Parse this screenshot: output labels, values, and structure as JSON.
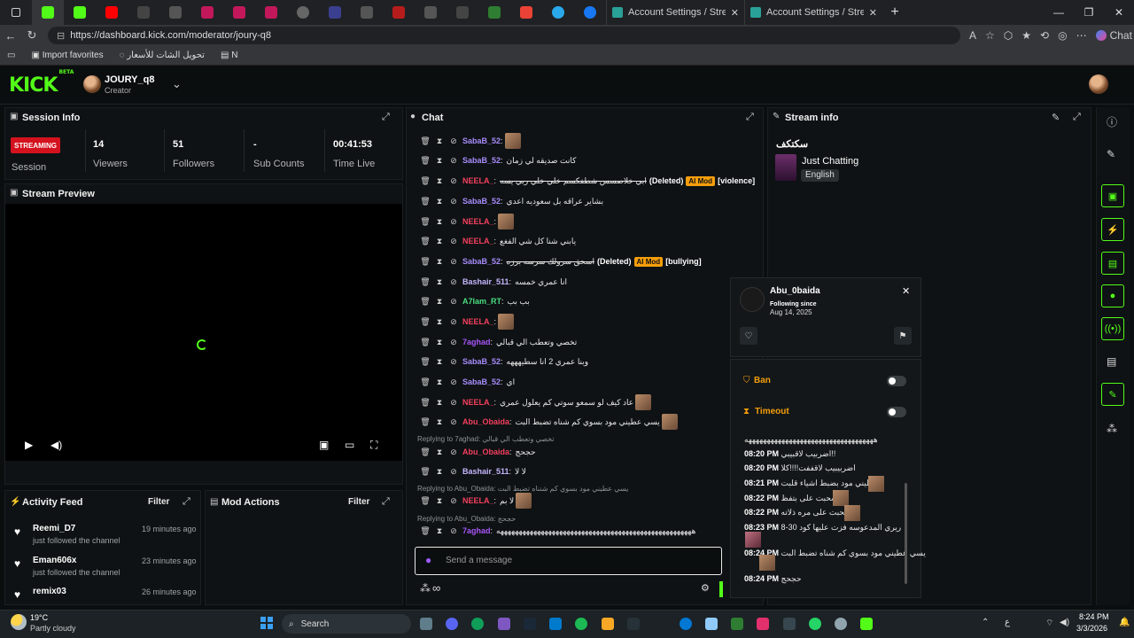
{
  "browser": {
    "tabs": [
      {
        "title": "Account Settings / Streamlabs"
      },
      {
        "title": "Account Settings / Streamlabs"
      }
    ],
    "url": "https://dashboard.kick.com/moderator/joury-q8",
    "favorites": [
      "Import favorites",
      "تحويل الشات للأسعار",
      "N"
    ],
    "copilot_label": "Chat"
  },
  "header": {
    "logo": "KICK",
    "logo_badge": "BETA",
    "channel_name": "JOURY_q8",
    "channel_role": "Creator"
  },
  "session": {
    "title": "Session Info",
    "badge": "STREAMING",
    "stats": [
      {
        "value": "14",
        "label": "Viewers"
      },
      {
        "value": "51",
        "label": "Followers"
      },
      {
        "value": "-",
        "label": "Sub Counts"
      },
      {
        "value": "00:41:53",
        "label": "Time Live"
      }
    ],
    "session_label": "Session"
  },
  "stream_preview": {
    "title": "Stream Preview"
  },
  "activity": {
    "title": "Activity Feed",
    "filter": "Filter",
    "items": [
      {
        "name": "Reemi_D7",
        "desc": "just followed the channel",
        "time": "19 minutes ago"
      },
      {
        "name": "Eman606x",
        "desc": "just followed the channel",
        "time": "23 minutes ago"
      },
      {
        "name": "remix03",
        "desc": "",
        "time": "26 minutes ago"
      }
    ]
  },
  "mod_actions": {
    "title": "Mod Actions",
    "filter": "Filter"
  },
  "chat": {
    "title": "Chat",
    "messages": [
      {
        "user": "SabaB_52",
        "text": "",
        "color": "#a78bfa"
      },
      {
        "user": "SabaB_52",
        "text": "كانت صديقه لي زمان",
        "color": "#a78bfa"
      },
      {
        "user": "NEELA_",
        "text": "ابي خلاصسس شطفكسم خلي خلي ربي يسه",
        "color": "#f43f5e",
        "deleted": "(Deleted)",
        "ai": "AI Mod",
        "reason": "[violence]"
      },
      {
        "user": "SabaB_52",
        "text": "بشاير عراقه بل سعوديه اعدي",
        "color": "#a78bfa"
      },
      {
        "user": "NEELA_",
        "text": "",
        "color": "#f43f5e"
      },
      {
        "user": "NEELA_",
        "text": "يابني شنا كل شي الفغع",
        "color": "#f43f5e"
      },
      {
        "user": "SabaB_52",
        "text": "اسحق سرولك سرسه برزه",
        "color": "#a78bfa",
        "deleted": "(Deleted)",
        "ai": "AI Mod",
        "reason": "[bullying]"
      },
      {
        "user": "Bashair_511",
        "text": "انا عمري خمسه",
        "color": "#c4b5fd"
      },
      {
        "user": "A7lam_RT",
        "text": "بب بب",
        "color": "#4ade80"
      },
      {
        "user": "NEELA_",
        "text": "",
        "color": "#f43f5e"
      },
      {
        "user": "7aghad",
        "text": "تخصي وتعطب الي قبالي",
        "color": "#a855f7"
      },
      {
        "user": "SabaB_52",
        "text": "وبنا عمري 2 انا سطيهههه",
        "color": "#a78bfa"
      },
      {
        "user": "SabaB_52",
        "text": "اي",
        "color": "#a78bfa"
      },
      {
        "user": "NEELA_",
        "text": "عاد كيف لو سمعو سوتي كم يعلول عمري",
        "color": "#f43f5e"
      },
      {
        "user": "Abu_Obaida",
        "text": "يسي عطيني مود بسوي كم شناه تضبط البت",
        "color": "#f43f5e"
      },
      {
        "reply": "Replying to 7aghad: تخصي وتعطب الي قبالي"
      },
      {
        "user": "Abu_Obaida",
        "text": "حجحج",
        "color": "#f43f5e"
      },
      {
        "user": "Bashair_511",
        "text": "لا لا",
        "color": "#c4b5fd"
      },
      {
        "reply": "Replying to Abu_Obaida: يسي عطيني مود بسوي كم شنناه تضبط البت"
      },
      {
        "user": "NEELA_",
        "text": "لا بم",
        "color": "#f43f5e"
      },
      {
        "reply": "Replying to Abu_Obaida: حجحج"
      },
      {
        "user": "7aghad",
        "text": "هههههههههههههههههههههههههههههههههههههههههههههههههههههه",
        "color": "#a855f7"
      }
    ],
    "input_placeholder": "Send a message"
  },
  "stream_info": {
    "title": "Stream info",
    "stream_title": "سكتكف",
    "category": "Just Chatting",
    "language": "English"
  },
  "user_card": {
    "username": "Abu_0baida",
    "following_label": "Following since",
    "following_date": "Aug 14, 2025",
    "ban_label": "Ban",
    "timeout_label": "Timeout",
    "history": [
      {
        "time": "",
        "text": "هههههههههههههههههههههههههههههههههههه"
      },
      {
        "time": "08:20 PM",
        "text": "اضربيب لاقبيبي!!"
      },
      {
        "time": "08:20 PM",
        "text": "اضربيبيب لاقففت!!!!كلا"
      },
      {
        "time": "08:21 PM",
        "text": "عطيني مود بضبط اشياء قلبت"
      },
      {
        "time": "08:22 PM",
        "text": "سحبت على بتفظ"
      },
      {
        "time": "08:22 PM",
        "text": "سحبت على مره ذلاته"
      },
      {
        "time": "08:23 PM",
        "text": "ريري المدعوسه فزت عليها كود 30-8"
      },
      {
        "time": "08:24 PM",
        "text": "يسي عطيني مود بسوي كم شناه تضبط البت"
      },
      {
        "time": "08:24 PM",
        "text": "حجحج"
      }
    ]
  },
  "taskbar": {
    "weather_temp": "19°C",
    "weather_desc": "Partly cloudy",
    "search": "Search",
    "time": "8:24 PM",
    "date": "3/3/2026"
  },
  "colors": {
    "accent": "#53fc18",
    "live": "#d4121e",
    "ai_mod": "#f59e0b"
  }
}
